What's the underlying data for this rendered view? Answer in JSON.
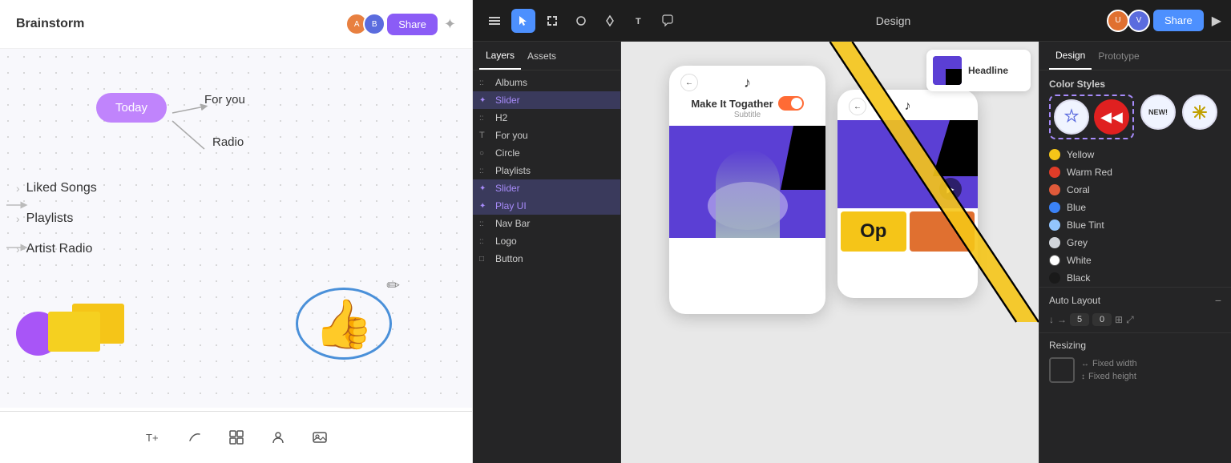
{
  "left": {
    "title": "Brainstorm",
    "share_label": "Share",
    "nodes": {
      "today": "Today",
      "for_you": "For you",
      "radio": "Radio"
    },
    "items": [
      "Liked Songs",
      "Playlists",
      "Artist Radio"
    ],
    "bottom_tools": [
      "T+",
      "~",
      "⊕",
      "👤",
      "🖼"
    ]
  },
  "figma": {
    "toolbar": {
      "design_label": "Design",
      "share_label": "Share"
    },
    "tabs": {
      "design": "Design",
      "prototype": "Prototype"
    },
    "layers": {
      "tabs": [
        "Layers",
        "Assets"
      ],
      "items": [
        {
          "icon": "grid",
          "label": "Albums",
          "type": "frame"
        },
        {
          "icon": "plus",
          "label": "Slider",
          "type": "component"
        },
        {
          "icon": "grid",
          "label": "H2",
          "type": "frame"
        },
        {
          "icon": "T",
          "label": "For you",
          "type": "text"
        },
        {
          "icon": "○",
          "label": "Circle",
          "type": "circle"
        },
        {
          "icon": "grid",
          "label": "Playlists",
          "type": "frame"
        },
        {
          "icon": "plus",
          "label": "Slider",
          "type": "component"
        },
        {
          "icon": "plus",
          "label": "Play UI",
          "type": "component"
        },
        {
          "icon": "grid",
          "label": "Nav Bar",
          "type": "frame"
        },
        {
          "icon": "grid",
          "label": "Logo",
          "type": "frame"
        },
        {
          "icon": "□",
          "label": "Button",
          "type": "rect"
        }
      ]
    },
    "properties": {
      "tabs": [
        "Design",
        "Prototype"
      ],
      "color_styles_title": "Color Styles",
      "colors": [
        {
          "name": "Yellow",
          "hex": "#f5c518"
        },
        {
          "name": "Warm Red",
          "hex": "#e03c28"
        },
        {
          "name": "Coral",
          "hex": "#e05a3a"
        },
        {
          "name": "Blue",
          "hex": "#3b82f6"
        },
        {
          "name": "Blue Tint",
          "hex": "#93c5fd"
        },
        {
          "name": "Grey",
          "hex": "#d1d5db"
        },
        {
          "name": "White",
          "hex": "#ffffff"
        },
        {
          "name": "Black",
          "hex": "#1a1a1a"
        }
      ],
      "auto_layout_title": "Auto Layout",
      "auto_layout_values": {
        "gap": "5",
        "padding": "0"
      },
      "resizing_title": "Resizing",
      "fixed_width": "Fixed width",
      "fixed_height": "Fixed height"
    },
    "canvas": {
      "phone1": {
        "title": "Make It Togather",
        "subtitle": "Subtitle"
      },
      "headline_label": "Headline"
    }
  }
}
